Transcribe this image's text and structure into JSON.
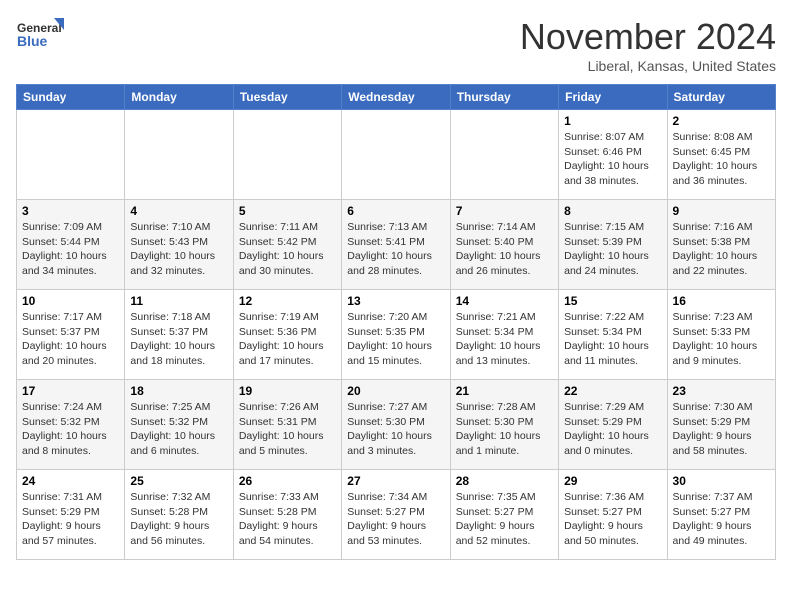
{
  "logo": {
    "line1": "General",
    "line2": "Blue"
  },
  "title": "November 2024",
  "location": "Liberal, Kansas, United States",
  "weekdays": [
    "Sunday",
    "Monday",
    "Tuesday",
    "Wednesday",
    "Thursday",
    "Friday",
    "Saturday"
  ],
  "weeks": [
    [
      {
        "day": "",
        "info": ""
      },
      {
        "day": "",
        "info": ""
      },
      {
        "day": "",
        "info": ""
      },
      {
        "day": "",
        "info": ""
      },
      {
        "day": "",
        "info": ""
      },
      {
        "day": "1",
        "info": "Sunrise: 8:07 AM\nSunset: 6:46 PM\nDaylight: 10 hours and 38 minutes."
      },
      {
        "day": "2",
        "info": "Sunrise: 8:08 AM\nSunset: 6:45 PM\nDaylight: 10 hours and 36 minutes."
      }
    ],
    [
      {
        "day": "3",
        "info": "Sunrise: 7:09 AM\nSunset: 5:44 PM\nDaylight: 10 hours and 34 minutes."
      },
      {
        "day": "4",
        "info": "Sunrise: 7:10 AM\nSunset: 5:43 PM\nDaylight: 10 hours and 32 minutes."
      },
      {
        "day": "5",
        "info": "Sunrise: 7:11 AM\nSunset: 5:42 PM\nDaylight: 10 hours and 30 minutes."
      },
      {
        "day": "6",
        "info": "Sunrise: 7:13 AM\nSunset: 5:41 PM\nDaylight: 10 hours and 28 minutes."
      },
      {
        "day": "7",
        "info": "Sunrise: 7:14 AM\nSunset: 5:40 PM\nDaylight: 10 hours and 26 minutes."
      },
      {
        "day": "8",
        "info": "Sunrise: 7:15 AM\nSunset: 5:39 PM\nDaylight: 10 hours and 24 minutes."
      },
      {
        "day": "9",
        "info": "Sunrise: 7:16 AM\nSunset: 5:38 PM\nDaylight: 10 hours and 22 minutes."
      }
    ],
    [
      {
        "day": "10",
        "info": "Sunrise: 7:17 AM\nSunset: 5:37 PM\nDaylight: 10 hours and 20 minutes."
      },
      {
        "day": "11",
        "info": "Sunrise: 7:18 AM\nSunset: 5:37 PM\nDaylight: 10 hours and 18 minutes."
      },
      {
        "day": "12",
        "info": "Sunrise: 7:19 AM\nSunset: 5:36 PM\nDaylight: 10 hours and 17 minutes."
      },
      {
        "day": "13",
        "info": "Sunrise: 7:20 AM\nSunset: 5:35 PM\nDaylight: 10 hours and 15 minutes."
      },
      {
        "day": "14",
        "info": "Sunrise: 7:21 AM\nSunset: 5:34 PM\nDaylight: 10 hours and 13 minutes."
      },
      {
        "day": "15",
        "info": "Sunrise: 7:22 AM\nSunset: 5:34 PM\nDaylight: 10 hours and 11 minutes."
      },
      {
        "day": "16",
        "info": "Sunrise: 7:23 AM\nSunset: 5:33 PM\nDaylight: 10 hours and 9 minutes."
      }
    ],
    [
      {
        "day": "17",
        "info": "Sunrise: 7:24 AM\nSunset: 5:32 PM\nDaylight: 10 hours and 8 minutes."
      },
      {
        "day": "18",
        "info": "Sunrise: 7:25 AM\nSunset: 5:32 PM\nDaylight: 10 hours and 6 minutes."
      },
      {
        "day": "19",
        "info": "Sunrise: 7:26 AM\nSunset: 5:31 PM\nDaylight: 10 hours and 5 minutes."
      },
      {
        "day": "20",
        "info": "Sunrise: 7:27 AM\nSunset: 5:30 PM\nDaylight: 10 hours and 3 minutes."
      },
      {
        "day": "21",
        "info": "Sunrise: 7:28 AM\nSunset: 5:30 PM\nDaylight: 10 hours and 1 minute."
      },
      {
        "day": "22",
        "info": "Sunrise: 7:29 AM\nSunset: 5:29 PM\nDaylight: 10 hours and 0 minutes."
      },
      {
        "day": "23",
        "info": "Sunrise: 7:30 AM\nSunset: 5:29 PM\nDaylight: 9 hours and 58 minutes."
      }
    ],
    [
      {
        "day": "24",
        "info": "Sunrise: 7:31 AM\nSunset: 5:29 PM\nDaylight: 9 hours and 57 minutes."
      },
      {
        "day": "25",
        "info": "Sunrise: 7:32 AM\nSunset: 5:28 PM\nDaylight: 9 hours and 56 minutes."
      },
      {
        "day": "26",
        "info": "Sunrise: 7:33 AM\nSunset: 5:28 PM\nDaylight: 9 hours and 54 minutes."
      },
      {
        "day": "27",
        "info": "Sunrise: 7:34 AM\nSunset: 5:27 PM\nDaylight: 9 hours and 53 minutes."
      },
      {
        "day": "28",
        "info": "Sunrise: 7:35 AM\nSunset: 5:27 PM\nDaylight: 9 hours and 52 minutes."
      },
      {
        "day": "29",
        "info": "Sunrise: 7:36 AM\nSunset: 5:27 PM\nDaylight: 9 hours and 50 minutes."
      },
      {
        "day": "30",
        "info": "Sunrise: 7:37 AM\nSunset: 5:27 PM\nDaylight: 9 hours and 49 minutes."
      }
    ]
  ]
}
